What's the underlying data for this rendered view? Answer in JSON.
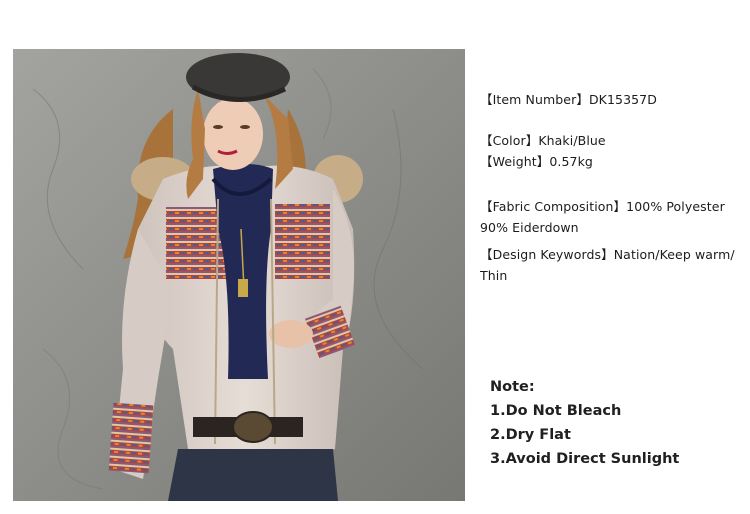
{
  "product_image": {
    "description_icon": "model-wearing-down-jacket-photo"
  },
  "specs": {
    "item_number": "【Item Number】DK15357D",
    "color": "【Color】Khaki/Blue",
    "weight": "【Weight】0.57kg",
    "fabric_line1": "【Fabric Composition】100% Polyester",
    "fabric_line2": "90% Eiderdown",
    "keywords_line1": "【Design Keywords】Nation/Keep warm/",
    "keywords_line2": "Thin"
  },
  "care": {
    "title": "Note:",
    "items": [
      "1.Do Not Bleach",
      "2.Dry Flat",
      "3.Avoid Direct Sunlight"
    ]
  },
  "colors": {
    "background": "#ffffff",
    "wall": "#8f8f8c",
    "jacket": "#d9cfc8",
    "sweater": "#232a55",
    "fur": "#c9b08a",
    "beret": "#3a3836",
    "hair": "#b07a3e",
    "text": "#1c1c1c"
  }
}
